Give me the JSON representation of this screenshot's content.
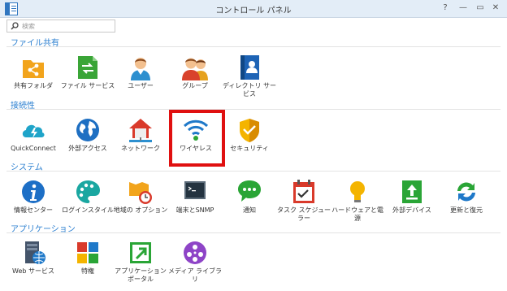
{
  "window": {
    "title": "コントロール パネル",
    "controls": [
      "?",
      "—",
      "▭",
      "✕"
    ]
  },
  "search": {
    "placeholder": "検索"
  },
  "sections": {
    "file_sharing": {
      "label": "ファイル共有",
      "items": [
        {
          "label": "共有フォルダ",
          "icon": "shared-folder-icon"
        },
        {
          "label": "ファイル サービス",
          "icon": "file-services-icon"
        },
        {
          "label": "ユーザー",
          "icon": "user-icon"
        },
        {
          "label": "グループ",
          "icon": "group-icon"
        },
        {
          "label": "ディレクトリ サービス",
          "icon": "directory-service-icon"
        }
      ]
    },
    "connectivity": {
      "label": "接続性",
      "items": [
        {
          "label": "QuickConnect",
          "icon": "quickconnect-icon"
        },
        {
          "label": "外部アクセス",
          "icon": "external-access-icon"
        },
        {
          "label": "ネットワーク",
          "icon": "network-icon"
        },
        {
          "label": "ワイヤレス",
          "icon": "wireless-icon"
        },
        {
          "label": "セキュリティ",
          "icon": "security-icon"
        }
      ]
    },
    "system": {
      "label": "システム",
      "items": [
        {
          "label": "情報センター",
          "icon": "info-center-icon"
        },
        {
          "label": "ログインスタイル",
          "icon": "login-style-icon"
        },
        {
          "label": "地域の オプション",
          "icon": "regional-options-icon"
        },
        {
          "label": "端末とSNMP",
          "icon": "terminal-snmp-icon"
        },
        {
          "label": "通知",
          "icon": "notification-icon"
        },
        {
          "label": "タスク スケジューラー",
          "icon": "task-scheduler-icon"
        },
        {
          "label": "ハードウェアと電源",
          "icon": "hardware-power-icon"
        },
        {
          "label": "外部デバイス",
          "icon": "external-devices-icon"
        },
        {
          "label": "更新と復元",
          "icon": "update-restore-icon"
        }
      ]
    },
    "applications": {
      "label": "アプリケーション",
      "items": [
        {
          "label": "Web サービス",
          "icon": "web-services-icon"
        },
        {
          "label": "特権",
          "icon": "privileges-icon"
        },
        {
          "label": "アプリケーション ポータル",
          "icon": "application-portal-icon"
        },
        {
          "label": "メディア ライブラリ",
          "icon": "media-library-icon"
        }
      ]
    }
  },
  "highlight": {
    "target": "ワイヤレス",
    "color": "#e01010"
  },
  "colors": {
    "accent": "#2b7fd0",
    "titlebar": "#e3edf7"
  }
}
